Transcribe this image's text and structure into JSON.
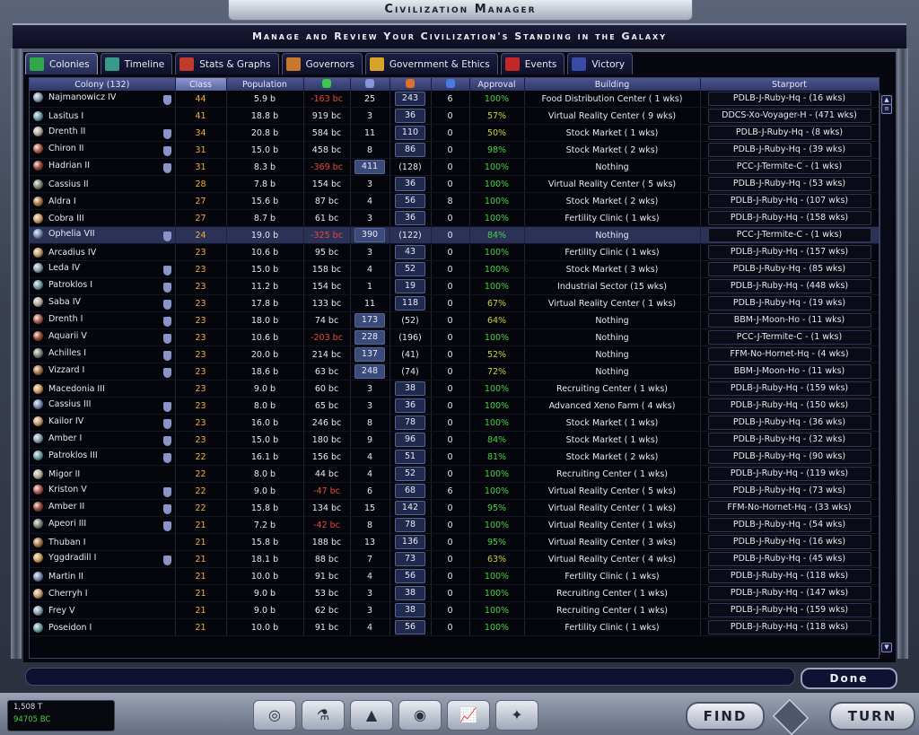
{
  "title": "Civilization Manager",
  "subtitle": "Manage and Review Your Civilization's Standing in the Galaxy",
  "tabs": [
    {
      "label": "Colonies",
      "icon": "leaf-icon",
      "color": "#2ea84a"
    },
    {
      "label": "Timeline",
      "icon": "line-graph-icon",
      "color": "#3a9a8a"
    },
    {
      "label": "Stats & Graphs",
      "icon": "bar-chart-icon",
      "color": "#c23a2a"
    },
    {
      "label": "Governors",
      "icon": "swap-arrows-icon",
      "color": "#c8782a"
    },
    {
      "label": "Government & Ethics",
      "icon": "scales-icon",
      "color": "#d8a428"
    },
    {
      "label": "Events",
      "icon": "alert-icon",
      "color": "#c22828"
    },
    {
      "label": "Victory",
      "icon": "flag-icon",
      "color": "#3a4aa8"
    }
  ],
  "columns": [
    "Colony (132)",
    "Class",
    "Population",
    "",
    "",
    "",
    "",
    "Approval",
    "Building",
    "Starport"
  ],
  "col_icons": [
    "",
    "",
    "",
    "money-icon",
    "shield-icon",
    "factory-icon",
    "research-icon",
    "",
    "",
    ""
  ],
  "rows": [
    {
      "name": "Najmanowicz IV",
      "shield": true,
      "class": "44",
      "pop": "5.9 b",
      "income": "-163 bc",
      "def": "25",
      "prod": "243",
      "res": "6",
      "approval": "100%",
      "building": "Food Distribution Center ( 1 wks)",
      "starport": "PDLB-J-Ruby-Hq - (16 wks)"
    },
    {
      "name": "Lasitus I",
      "shield": false,
      "class": "41",
      "pop": "18.8 b",
      "income": "919 bc",
      "def": "3",
      "prod": "36",
      "res": "0",
      "approval": "57%",
      "building": "Virtual Reality Center ( 9 wks)",
      "starport": "DDCS-Xo-Voyager-H - (471 wks)"
    },
    {
      "name": "Drenth II",
      "shield": true,
      "class": "34",
      "pop": "20.8 b",
      "income": "584 bc",
      "def": "11",
      "prod": "110",
      "res": "0",
      "approval": "50%",
      "building": "Stock Market ( 1 wks)",
      "starport": "PDLB-J-Ruby-Hq - (8 wks)"
    },
    {
      "name": "Chiron II",
      "shield": true,
      "class": "31",
      "pop": "15.0 b",
      "income": "458 bc",
      "def": "8",
      "prod": "86",
      "res": "0",
      "approval": "98%",
      "building": "Stock Market ( 2 wks)",
      "starport": "PDLB-J-Ruby-Hq - (39 wks)"
    },
    {
      "name": "Hadrian II",
      "shield": true,
      "class": "31",
      "pop": "8.3 b",
      "income": "-369 bc",
      "def": "411",
      "prod": "(128)",
      "res": "0",
      "approval": "100%",
      "building": "Nothing",
      "starport": "PCC-J-Termite-C - (1 wks)"
    },
    {
      "name": "Cassius II",
      "shield": false,
      "class": "28",
      "pop": "7.8 b",
      "income": "154 bc",
      "def": "3",
      "prod": "36",
      "res": "0",
      "approval": "100%",
      "building": "Virtual Reality Center ( 5 wks)",
      "starport": "PDLB-J-Ruby-Hq - (53 wks)"
    },
    {
      "name": "Aldra I",
      "shield": false,
      "class": "27",
      "pop": "15.6 b",
      "income": "87 bc",
      "def": "4",
      "prod": "56",
      "res": "8",
      "approval": "100%",
      "building": "Stock Market ( 2 wks)",
      "starport": "PDLB-J-Ruby-Hq - (107 wks)"
    },
    {
      "name": "Cobra III",
      "shield": false,
      "class": "27",
      "pop": "8.7 b",
      "income": "61 bc",
      "def": "3",
      "prod": "36",
      "res": "0",
      "approval": "100%",
      "building": "Fertility Clinic ( 1 wks)",
      "starport": "PDLB-J-Ruby-Hq - (158 wks)"
    },
    {
      "name": "Ophelia VII",
      "shield": true,
      "class": "24",
      "pop": "19.0 b",
      "income": "-325 bc",
      "def": "390",
      "prod": "(122)",
      "res": "0",
      "approval": "84%",
      "building": "Nothing",
      "starport": "PCC-J-Termite-C - (1 wks)"
    },
    {
      "name": "Arcadius IV",
      "shield": false,
      "class": "23",
      "pop": "10.6 b",
      "income": "95 bc",
      "def": "3",
      "prod": "43",
      "res": "0",
      "approval": "100%",
      "building": "Fertility Clinic ( 1 wks)",
      "starport": "PDLB-J-Ruby-Hq - (157 wks)"
    },
    {
      "name": "Leda IV",
      "shield": true,
      "class": "23",
      "pop": "15.0 b",
      "income": "158 bc",
      "def": "4",
      "prod": "52",
      "res": "0",
      "approval": "100%",
      "building": "Stock Market ( 3 wks)",
      "starport": "PDLB-J-Ruby-Hq - (85 wks)"
    },
    {
      "name": "Patroklos I",
      "shield": true,
      "class": "23",
      "pop": "11.2 b",
      "income": "154 bc",
      "def": "1",
      "prod": "19",
      "res": "0",
      "approval": "100%",
      "building": "Industrial Sector (15 wks)",
      "starport": "PDLB-J-Ruby-Hq - (448 wks)"
    },
    {
      "name": "Saba IV",
      "shield": true,
      "class": "23",
      "pop": "17.8 b",
      "income": "133 bc",
      "def": "11",
      "prod": "118",
      "res": "0",
      "approval": "67%",
      "building": "Virtual Reality Center ( 1 wks)",
      "starport": "PDLB-J-Ruby-Hq - (19 wks)"
    },
    {
      "name": "Drenth I",
      "shield": true,
      "class": "23",
      "pop": "18.0 b",
      "income": "74 bc",
      "def": "173",
      "prod": "(52)",
      "res": "0",
      "approval": "64%",
      "building": "Nothing",
      "starport": "BBM-J-Moon-Ho - (11 wks)"
    },
    {
      "name": "Aquarii V",
      "shield": true,
      "class": "23",
      "pop": "10.6 b",
      "income": "-203 bc",
      "def": "228",
      "prod": "(196)",
      "res": "0",
      "approval": "100%",
      "building": "Nothing",
      "starport": "PCC-J-Termite-C - (1 wks)"
    },
    {
      "name": "Achilles I",
      "shield": true,
      "class": "23",
      "pop": "20.0 b",
      "income": "214 bc",
      "def": "137",
      "prod": "(41)",
      "res": "0",
      "approval": "52%",
      "building": "Nothing",
      "starport": "FFM-No-Hornet-Hq - (4 wks)"
    },
    {
      "name": "Vizzard I",
      "shield": true,
      "class": "23",
      "pop": "18.6 b",
      "income": "63 bc",
      "def": "248",
      "prod": "(74)",
      "res": "0",
      "approval": "72%",
      "building": "Nothing",
      "starport": "BBM-J-Moon-Ho - (11 wks)"
    },
    {
      "name": "Macedonia III",
      "shield": false,
      "class": "23",
      "pop": "9.0 b",
      "income": "60 bc",
      "def": "3",
      "prod": "38",
      "res": "0",
      "approval": "100%",
      "building": "Recruiting Center ( 1 wks)",
      "starport": "PDLB-J-Ruby-Hq - (159 wks)"
    },
    {
      "name": "Cassius III",
      "shield": true,
      "class": "23",
      "pop": "8.0 b",
      "income": "65 bc",
      "def": "3",
      "prod": "36",
      "res": "0",
      "approval": "100%",
      "building": "Advanced Xeno Farm ( 4 wks)",
      "starport": "PDLB-J-Ruby-Hq - (150 wks)"
    },
    {
      "name": "Kailor IV",
      "shield": true,
      "class": "23",
      "pop": "16.0 b",
      "income": "246 bc",
      "def": "8",
      "prod": "78",
      "res": "0",
      "approval": "100%",
      "building": "Stock Market ( 1 wks)",
      "starport": "PDLB-J-Ruby-Hq - (36 wks)"
    },
    {
      "name": "Amber I",
      "shield": true,
      "class": "23",
      "pop": "15.0 b",
      "income": "180 bc",
      "def": "9",
      "prod": "96",
      "res": "0",
      "approval": "84%",
      "building": "Stock Market ( 1 wks)",
      "starport": "PDLB-J-Ruby-Hq - (32 wks)"
    },
    {
      "name": "Patroklos III",
      "shield": true,
      "class": "22",
      "pop": "16.1 b",
      "income": "156 bc",
      "def": "4",
      "prod": "51",
      "res": "0",
      "approval": "81%",
      "building": "Stock Market ( 2 wks)",
      "starport": "PDLB-J-Ruby-Hq - (90 wks)"
    },
    {
      "name": "Migor II",
      "shield": false,
      "class": "22",
      "pop": "8.0 b",
      "income": "44 bc",
      "def": "4",
      "prod": "52",
      "res": "0",
      "approval": "100%",
      "building": "Recruiting Center ( 1 wks)",
      "starport": "PDLB-J-Ruby-Hq - (119 wks)"
    },
    {
      "name": "Kriston V",
      "shield": true,
      "class": "22",
      "pop": "9.0 b",
      "income": "-47 bc",
      "def": "6",
      "prod": "68",
      "res": "6",
      "approval": "100%",
      "building": "Virtual Reality Center ( 5 wks)",
      "starport": "PDLB-J-Ruby-Hq - (73 wks)"
    },
    {
      "name": "Amber II",
      "shield": true,
      "class": "22",
      "pop": "15.8 b",
      "income": "134 bc",
      "def": "15",
      "prod": "142",
      "res": "0",
      "approval": "95%",
      "building": "Virtual Reality Center ( 1 wks)",
      "starport": "FFM-No-Hornet-Hq - (33 wks)"
    },
    {
      "name": "Apeori III",
      "shield": true,
      "class": "21",
      "pop": "7.2 b",
      "income": "-42 bc",
      "def": "8",
      "prod": "78",
      "res": "0",
      "approval": "100%",
      "building": "Virtual Reality Center ( 1 wks)",
      "starport": "PDLB-J-Ruby-Hq - (54 wks)"
    },
    {
      "name": "Thuban I",
      "shield": false,
      "class": "21",
      "pop": "15.8 b",
      "income": "188 bc",
      "def": "13",
      "prod": "136",
      "res": "0",
      "approval": "95%",
      "building": "Virtual Reality Center ( 3 wks)",
      "starport": "PDLB-J-Ruby-Hq - (16 wks)"
    },
    {
      "name": "Yggdradill I",
      "shield": true,
      "class": "21",
      "pop": "18.1 b",
      "income": "88 bc",
      "def": "7",
      "prod": "73",
      "res": "0",
      "approval": "63%",
      "building": "Virtual Reality Center ( 4 wks)",
      "starport": "PDLB-J-Ruby-Hq - (45 wks)"
    },
    {
      "name": "Martin II",
      "shield": false,
      "class": "21",
      "pop": "10.0 b",
      "income": "91 bc",
      "def": "4",
      "prod": "56",
      "res": "0",
      "approval": "100%",
      "building": "Fertility Clinic ( 1 wks)",
      "starport": "PDLB-J-Ruby-Hq - (118 wks)"
    },
    {
      "name": "Cherryh I",
      "shield": false,
      "class": "21",
      "pop": "9.0 b",
      "income": "53 bc",
      "def": "3",
      "prod": "38",
      "res": "0",
      "approval": "100%",
      "building": "Recruiting Center ( 1 wks)",
      "starport": "PDLB-J-Ruby-Hq - (147 wks)"
    },
    {
      "name": "Frey V",
      "shield": false,
      "class": "21",
      "pop": "9.0 b",
      "income": "62 bc",
      "def": "3",
      "prod": "38",
      "res": "0",
      "approval": "100%",
      "building": "Recruiting Center ( 1 wks)",
      "starport": "PDLB-J-Ruby-Hq - (159 wks)"
    },
    {
      "name": "Poseidon I",
      "shield": false,
      "class": "21",
      "pop": "10.0 b",
      "income": "91 bc",
      "def": "4",
      "prod": "56",
      "res": "0",
      "approval": "100%",
      "building": "Fertility Clinic ( 1 wks)",
      "starport": "PDLB-J-Ruby-Hq - (118 wks)"
    }
  ],
  "selected_row": 8,
  "done_label": "Done",
  "stats": {
    "population": "1,508 T",
    "credits": "94705 BC"
  },
  "find_label": "FIND",
  "turn_label": "TURN",
  "nav_buttons": [
    "galaxy-icon",
    "research-flask-icon",
    "planet-build-icon",
    "diplomacy-icon",
    "graph-icon",
    "ship-design-icon"
  ]
}
